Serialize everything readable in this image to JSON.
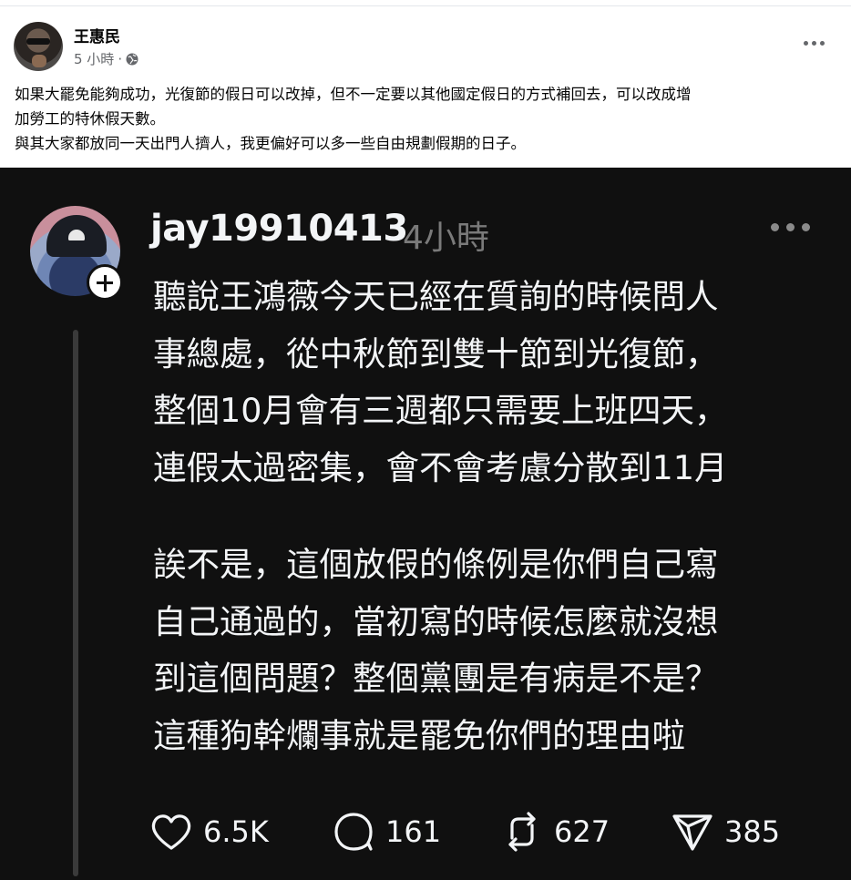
{
  "fb": {
    "author": "王惠民",
    "time": "5 小時",
    "separator": "·",
    "icons": {
      "privacy": "globe-icon",
      "more": "more-horizontal-icon"
    },
    "text_lines": [
      "如果大罷免能夠成功，光復節的假日可以改掉，但不一定要以其他國定假日的方式補回去，可以改成增",
      "加勞工的特休假天數。",
      "與其大家都放同一天出門人擠人，我更偏好可以多一些自由規劃假期的日子。"
    ]
  },
  "threads": {
    "username": "jay19910413",
    "time": "4小時",
    "icons": {
      "follow": "plus-icon",
      "more": "more-horizontal-icon"
    },
    "paragraph1": [
      "聽說王鴻薇今天已經在質詢的時候問人",
      "事總處，從中秋節到雙十節到光復節，",
      "整個10月會有三週都只需要上班四天，",
      "連假太過密集，會不會考慮分散到11月"
    ],
    "paragraph2": [
      "誒不是，這個放假的條例是你們自己寫",
      "自己通過的，當初寫的時候怎麼就沒想",
      "到這個問題？整個黨團是有病是不是？",
      "這種狗幹爛事就是罷免你們的理由啦"
    ],
    "actions": {
      "like": {
        "icon": "heart-icon",
        "count": "6.5K"
      },
      "reply": {
        "icon": "comment-icon",
        "count": "161"
      },
      "repost": {
        "icon": "repost-icon",
        "count": "627"
      },
      "share": {
        "icon": "send-icon",
        "count": "385"
      }
    }
  }
}
